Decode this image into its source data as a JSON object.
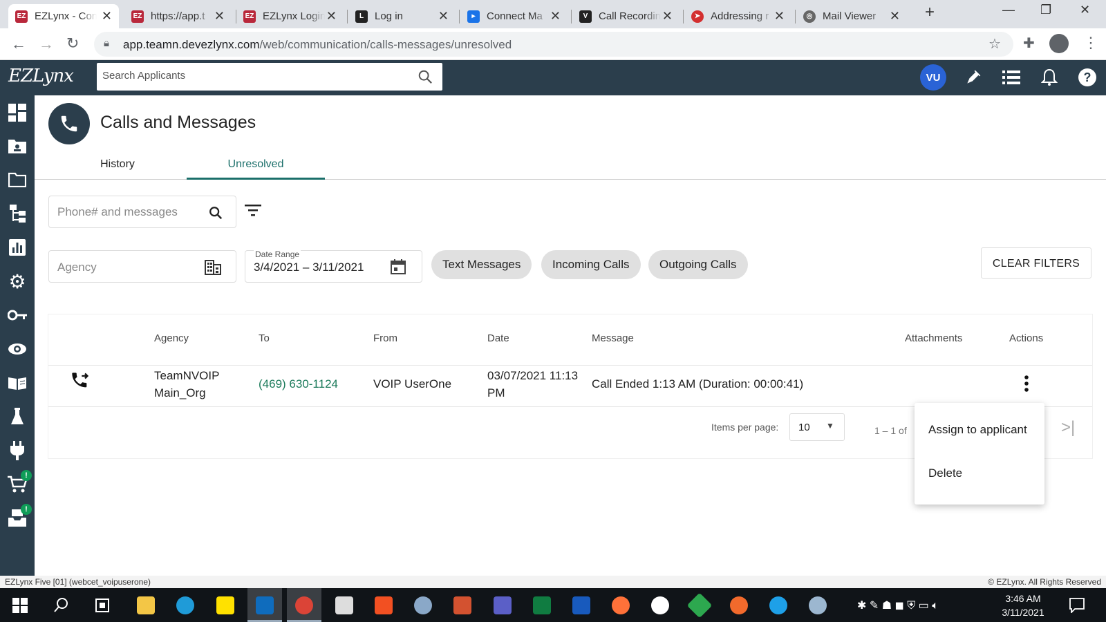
{
  "browser": {
    "tabs": [
      {
        "title": "EZLynx - Con",
        "active": true
      },
      {
        "title": "https://app.t"
      },
      {
        "title": "EZLynx Login"
      },
      {
        "title": "Log in"
      },
      {
        "title": "Connect Ma"
      },
      {
        "title": "Call Recordin"
      },
      {
        "title": "Addressing r"
      },
      {
        "title": "Mail Viewer"
      }
    ],
    "url_host": "app.teamn.devezlynx.com",
    "url_path": "/web/communication/calls-messages/unresolved"
  },
  "header": {
    "logo": "EZLynx",
    "search_placeholder": "Search Applicants",
    "avatar_initials": "VU"
  },
  "sidebar": {
    "badges": [
      "!",
      "!"
    ]
  },
  "page": {
    "title": "Calls and Messages",
    "tabs": [
      {
        "label": "History"
      },
      {
        "label": "Unresolved",
        "active": true
      }
    ]
  },
  "filters": {
    "search_placeholder": "Phone# and messages",
    "agency_placeholder": "Agency",
    "date_range_label": "Date Range",
    "date_range_value": "3/4/2021 – 3/11/2021",
    "chips": [
      "Text Messages",
      "Incoming Calls",
      "Outgoing Calls"
    ],
    "clear_label": "CLEAR FILTERS"
  },
  "table": {
    "headers": [
      "Agency",
      "To",
      "From",
      "Date",
      "Message",
      "Attachments",
      "Actions"
    ],
    "rows": [
      {
        "agency_line1": "TeamNVOIP",
        "agency_line2": "Main_Org",
        "to": "(469) 630-1124",
        "from": "VOIP UserOne",
        "date_line1": "03/07/2021 11:13",
        "date_line2": "PM",
        "message": "Call Ended 1:13 AM (Duration: 00:00:41)"
      }
    ],
    "items_per_page_label": "Items per page:",
    "items_per_page_value": "10",
    "range_label": "1 – 1 of"
  },
  "actions_menu": {
    "items": [
      "Assign to applicant",
      "Delete"
    ]
  },
  "status": {
    "left": "EZLynx Five [01] (webcet_voipuserone)",
    "right": "© EZLynx. All Rights Reserved"
  },
  "taskbar": {
    "time": "3:46 AM",
    "date": "3/11/2021"
  },
  "colors": {
    "header_bg": "#2b3e4c",
    "accent": "#1b6f6a",
    "avatar": "#2a63d6",
    "phone_link": "#1b7a5a"
  }
}
